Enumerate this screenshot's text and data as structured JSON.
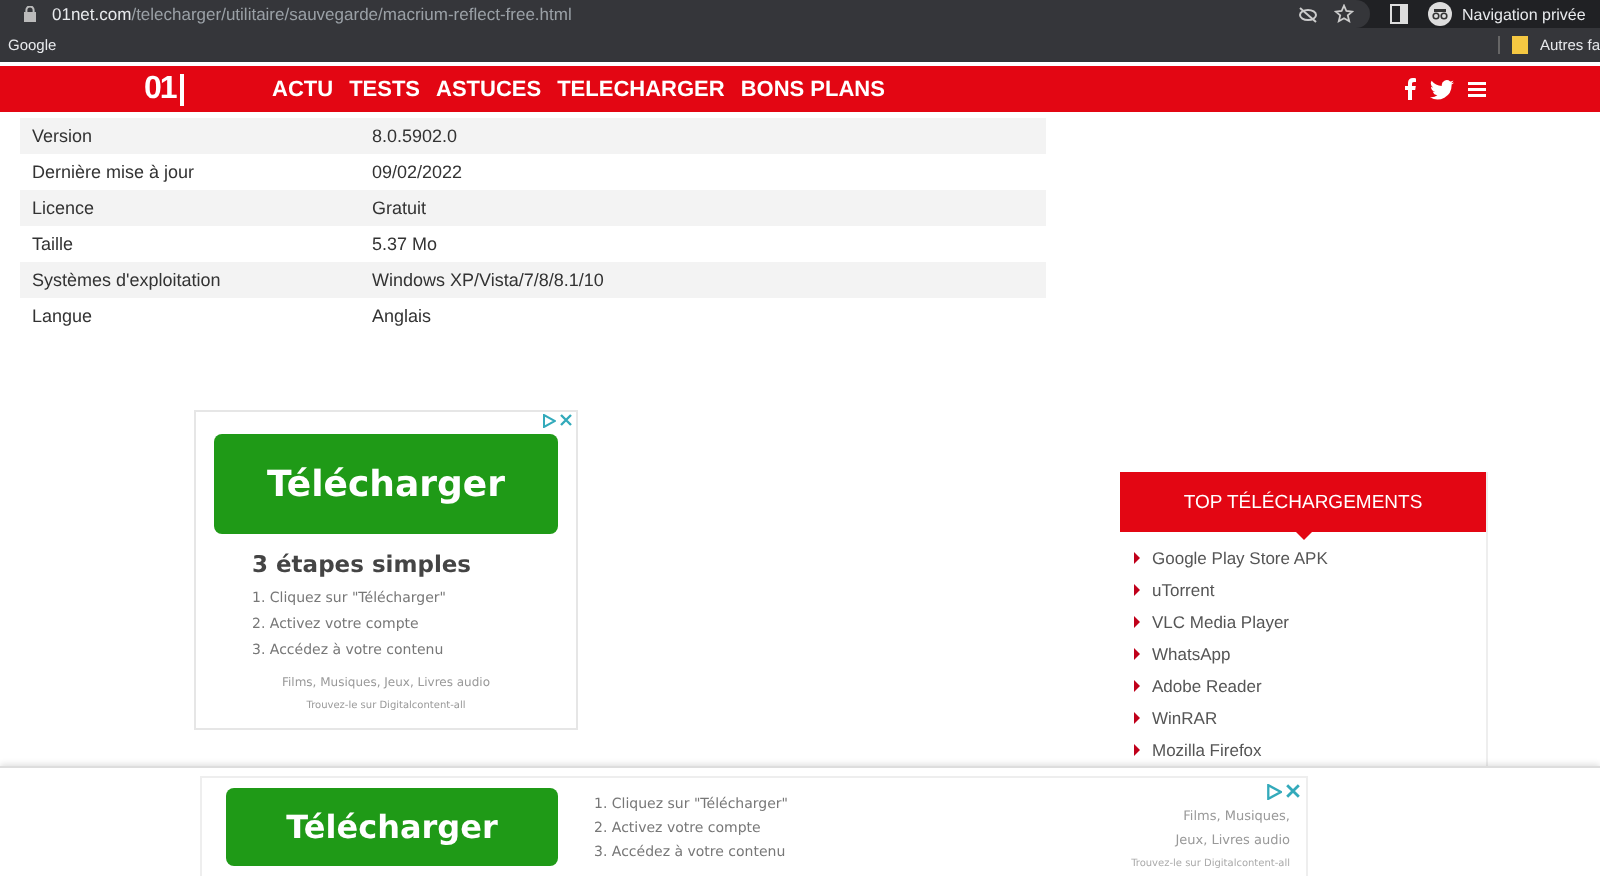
{
  "browser": {
    "url_domain": "01net.com",
    "url_path": "/telecharger/utilitaire/sauvegarde/macrium-reflect-free.html",
    "profile_label": "Navigation privée"
  },
  "bookmarks": {
    "left": "Google",
    "right": "Autres fa"
  },
  "nav": {
    "logo": "01",
    "items": [
      "ACTU",
      "TESTS",
      "ASTUCES",
      "TELECHARGER",
      "BONS PLANS"
    ]
  },
  "specs": [
    {
      "label": "Version",
      "value": "8.0.5902.0"
    },
    {
      "label": "Dernière mise à jour",
      "value": "09/02/2022"
    },
    {
      "label": "Licence",
      "value": "Gratuit"
    },
    {
      "label": "Taille",
      "value": "5.37 Mo"
    },
    {
      "label": "Systèmes d'exploitation",
      "value": "Windows XP/Vista/7/8/8.1/10"
    },
    {
      "label": "Langue",
      "value": "Anglais"
    }
  ],
  "ad": {
    "button": "Télécharger",
    "heading": "3 étapes simples",
    "steps": [
      "1. Cliquez sur \"Télécharger\"",
      "2. Activez votre compte",
      "3. Accédez à votre contenu"
    ],
    "tagline": "Films, Musiques, Jeux, Livres audio",
    "source": "Trouvez-le sur Digitalcontent-all"
  },
  "top_downloads": {
    "title": "TOP TÉLÉCHARGEMENTS",
    "items": [
      "Google Play Store APK",
      "uTorrent",
      "VLC Media Player",
      "WhatsApp",
      "Adobe Reader",
      "WinRAR",
      "Mozilla Firefox"
    ]
  },
  "bottom_ad": {
    "button": "Télécharger",
    "steps": [
      "1. Cliquez sur \"Télécharger\"",
      "2. Activez votre compte",
      "3. Accédez à votre contenu"
    ],
    "tagline_lines": [
      "Films, Musiques,",
      "Jeux, Livres audio"
    ],
    "source": "Trouvez-le sur Digitalcontent-all"
  }
}
